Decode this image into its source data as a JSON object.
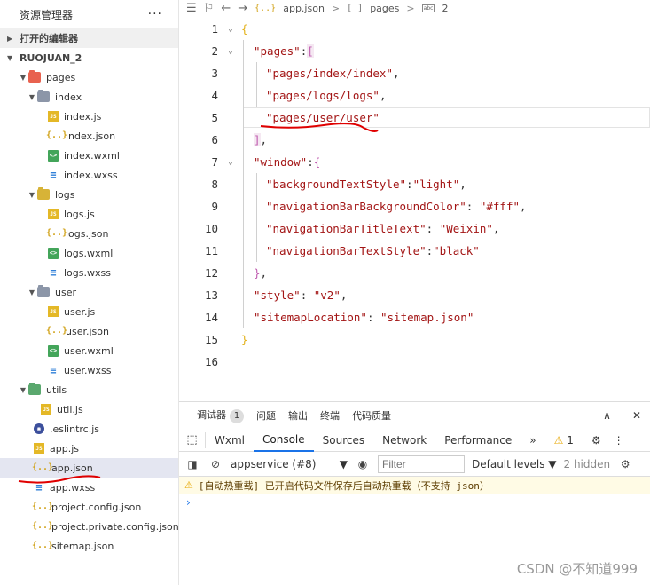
{
  "sidebar": {
    "title": "资源管理器",
    "more": "···",
    "open_editors": "打开的编辑器",
    "root": "RUOJUAN_2",
    "tree": {
      "pages": "pages",
      "index": "index",
      "index_js": "index.js",
      "index_json": "index.json",
      "index_wxml": "index.wxml",
      "index_wxss": "index.wxss",
      "logs": "logs",
      "logs_js": "logs.js",
      "logs_json": "logs.json",
      "logs_wxml": "logs.wxml",
      "logs_wxss": "logs.wxss",
      "user": "user",
      "user_js": "user.js",
      "user_json": "user.json",
      "user_wxml": "user.wxml",
      "user_wxss": "user.wxss",
      "utils": "utils",
      "util_js": "util.js",
      "eslintrc": ".eslintrc.js",
      "app_js": "app.js",
      "app_json": "app.json",
      "app_wxss": "app.wxss",
      "project_config": "project.config.json",
      "project_private": "project.private.config.json",
      "sitemap": "sitemap.json"
    }
  },
  "editor": {
    "breadcrumb": {
      "file_icon": "{..}",
      "file": "app.json",
      "sep": ">",
      "array_icon": "[ ]",
      "key": "pages",
      "abc_icon": "abc",
      "index": "2"
    },
    "lines": {
      "n1": "1",
      "n2": "2",
      "n3": "3",
      "n4": "4",
      "n5": "5",
      "n6": "6",
      "n7": "7",
      "n8": "8",
      "n9": "9",
      "n10": "10",
      "n11": "11",
      "n12": "12",
      "n13": "13",
      "n14": "14",
      "n15": "15",
      "n16": "16",
      "l1_brace": "{",
      "l2_key": "\"pages\"",
      "l2_colon": ":",
      "l2_bracket": "[",
      "l3_val": "\"pages/index/index\"",
      "l4_val": "\"pages/logs/logs\"",
      "l5_val": "\"pages/user/user\"",
      "l6_bracket": "]",
      "l7_key": "\"window\"",
      "l7_brace": "{",
      "l8_key": "\"backgroundTextStyle\"",
      "l8_val": "\"light\"",
      "l9_key": "\"navigationBarBackgroundColor\"",
      "l9_val": "\"#fff\"",
      "l10_key": "\"navigationBarTitleText\"",
      "l10_val": "\"Weixin\"",
      "l11_key": "\"navigationBarTextStyle\"",
      "l11_val": "\"black\"",
      "l12_brace": "}",
      "l13_key": "\"style\"",
      "l13_val": "\"v2\"",
      "l14_key": "\"sitemapLocation\"",
      "l14_val": "\"sitemap.json\"",
      "l15_brace": "}",
      "comma": ",",
      "colon": ":",
      "colon_sp": ": "
    }
  },
  "devtools": {
    "tabs_top": {
      "debugger": "调试器",
      "debugger_count": "1",
      "issues": "问题",
      "output": "输出",
      "terminal": "终端",
      "code_quality": "代码质量",
      "collapse": "∧",
      "close": "✕"
    },
    "tabs": {
      "wxml": "Wxml",
      "console": "Console",
      "sources": "Sources",
      "network": "Network",
      "performance": "Performance",
      "more": "»",
      "warn_count": "1"
    },
    "toolbar": {
      "context": "appservice (#8)",
      "context_arrow": "▼",
      "filter_placeholder": "Filter",
      "levels": "Default levels ▼",
      "hidden": "2 hidden"
    },
    "messages": {
      "warning": "[自动热重载] 已开启代码文件保存后自动热重载（不支持 json）",
      "prompt": "›"
    }
  },
  "watermark": "CSDN @不知道999",
  "colors": {
    "string": "#a31515",
    "bracket_gold": "#e3b21c",
    "bracket_purple": "#c05db0",
    "tab_accent": "#1a73e8",
    "annotation_red": "#e00000"
  }
}
